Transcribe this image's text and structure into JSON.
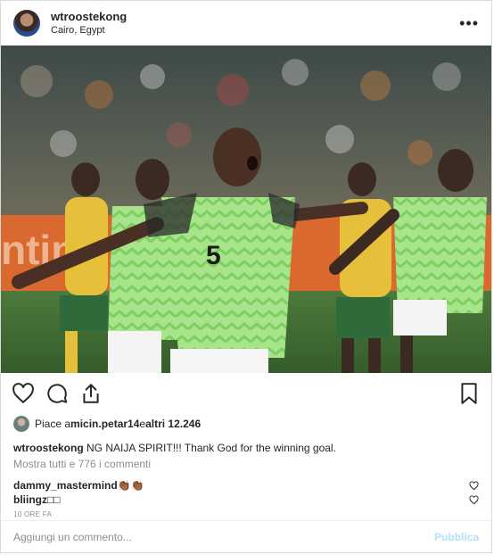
{
  "post": {
    "username": "wtroostekong",
    "location": "Cairo, Egypt",
    "more_icon": "more-horizontal-icon",
    "photo_alt": "Player in green-white jersey number 5 celebrating"
  },
  "actions": {
    "icons": [
      "heart-icon",
      "comment-icon",
      "share-icon",
      "bookmark-icon"
    ]
  },
  "likes": {
    "prefix": "Piace a ",
    "user": "micin.petar14",
    "middle": " e ",
    "others": "altri 12.246"
  },
  "caption": {
    "username": "wtroostekong",
    "text": " NG⁡ NAIJA SPIRIT!!! Thank God for the winning goal."
  },
  "view_all_comments": "Mostra tutti e 776 i commenti",
  "comments": [
    {
      "username": "dammy_mastermind",
      "text": " 👏🏾👏🏾"
    },
    {
      "username": "bliingz",
      "text": " □□"
    }
  ],
  "timestamp": "10 ORE FA",
  "footer": {
    "placeholder": "Aggiungi un commento...",
    "publish_label": "Pubblica"
  },
  "colors": {
    "jersey_green": "#9ee07f",
    "publish_disabled": "#b2dffc",
    "secondary_text": "#8e8e8e"
  }
}
